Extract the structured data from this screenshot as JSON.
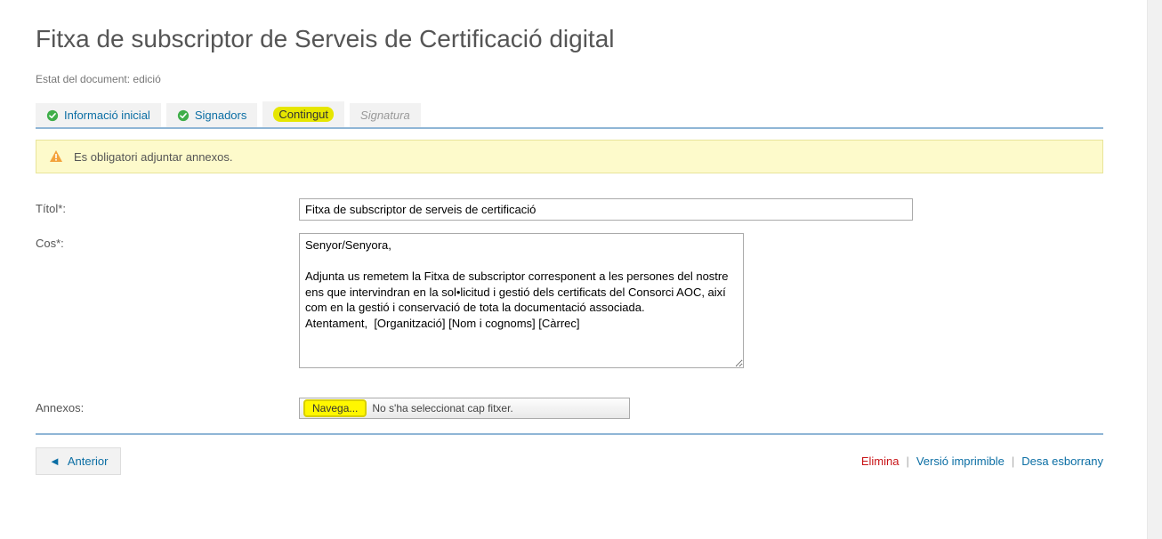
{
  "page": {
    "title": "Fitxa de subscriptor de Serveis de Certificació digital",
    "status_prefix": "Estat del document:",
    "status_value": "edició"
  },
  "tabs": {
    "info": "Informació inicial",
    "signadors": "Signadors",
    "contingut": "Contingut",
    "signatura": "Signatura"
  },
  "alert": {
    "message": "Es obligatori adjuntar annexos."
  },
  "form": {
    "title_label": "Títol*:",
    "title_value": "Fitxa de subscriptor de serveis de certificació",
    "body_label": "Cos*:",
    "body_value": "Senyor/Senyora,\n\nAdjunta us remetem la Fitxa de subscriptor corresponent a les persones del nostre ens que intervindran en la sol•licitud i gestió dels certificats del Consorci AOC, així com en la gestió i conservació de tota la documentació associada.\nAtentament,  [Organització] [Nom i cognoms] [Càrrec]",
    "annex_label": "Annexos:",
    "file_button": "Navega...",
    "file_status": "No s'ha seleccionat cap fitxer."
  },
  "footer": {
    "prev": "Anterior",
    "elimina": "Elimina",
    "print": "Versió imprimible",
    "draft": "Desa esborrany"
  }
}
